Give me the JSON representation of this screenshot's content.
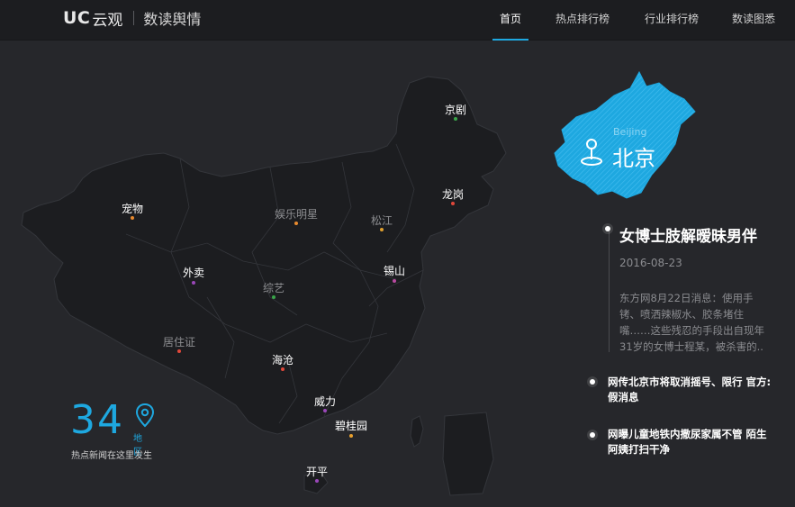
{
  "header": {
    "logo_brand": "UC",
    "logo_cn": "云观",
    "logo_sub": "数读舆情",
    "nav": [
      {
        "label": "首页",
        "active": true
      },
      {
        "label": "热点排行榜",
        "active": false
      },
      {
        "label": "行业排行榜",
        "active": false
      },
      {
        "label": "数读图悉",
        "active": false
      }
    ]
  },
  "map": {
    "cities": [
      {
        "label": "京剧",
        "dot_color": "#3aa64a",
        "dim": false
      },
      {
        "label": "龙岗",
        "dot_color": "#e0483a",
        "dim": false
      },
      {
        "label": "宠物",
        "dot_color": "#e88a2e",
        "dim": false
      },
      {
        "label": "娱乐明星",
        "dot_color": "#e88a2e",
        "dim": true
      },
      {
        "label": "松江",
        "dot_color": "#e0a02e",
        "dim": true
      },
      {
        "label": "外卖",
        "dot_color": "#9a47b8",
        "dim": false
      },
      {
        "label": "锡山",
        "dot_color": "#b84aa0",
        "dim": false
      },
      {
        "label": "综艺",
        "dot_color": "#3aa64a",
        "dim": true
      },
      {
        "label": "居住证",
        "dot_color": "#e0483a",
        "dim": true
      },
      {
        "label": "海沧",
        "dot_color": "#e0483a",
        "dim": false
      },
      {
        "label": "威力",
        "dot_color": "#9a47b8",
        "dim": false
      },
      {
        "label": "碧桂园",
        "dot_color": "#e8a02e",
        "dim": false
      },
      {
        "label": "开平",
        "dot_color": "#9a47b8",
        "dim": false
      }
    ],
    "accent_color": "#1ea8e0"
  },
  "stats": {
    "count": "34",
    "unit": "地区",
    "caption": "热点新闻在这里发生"
  },
  "region": {
    "name_en": "Beijing",
    "name_cn": "北京"
  },
  "news": {
    "featured": {
      "title": "女博士肢解暧昧男伴",
      "date": "2016-08-23",
      "body": "东方网8月22日消息：使用手铐、喷洒辣椒水、胶条堵住嘴……这些残忍的手段出自现年31岁的女博士程某，被杀害的.."
    },
    "items": [
      {
        "text": "网传北京市将取消摇号、限行 官方: 假消息"
      },
      {
        "text": "网曝儿童地铁内撒尿家属不管 陌生阿姨打扫干净"
      }
    ]
  }
}
